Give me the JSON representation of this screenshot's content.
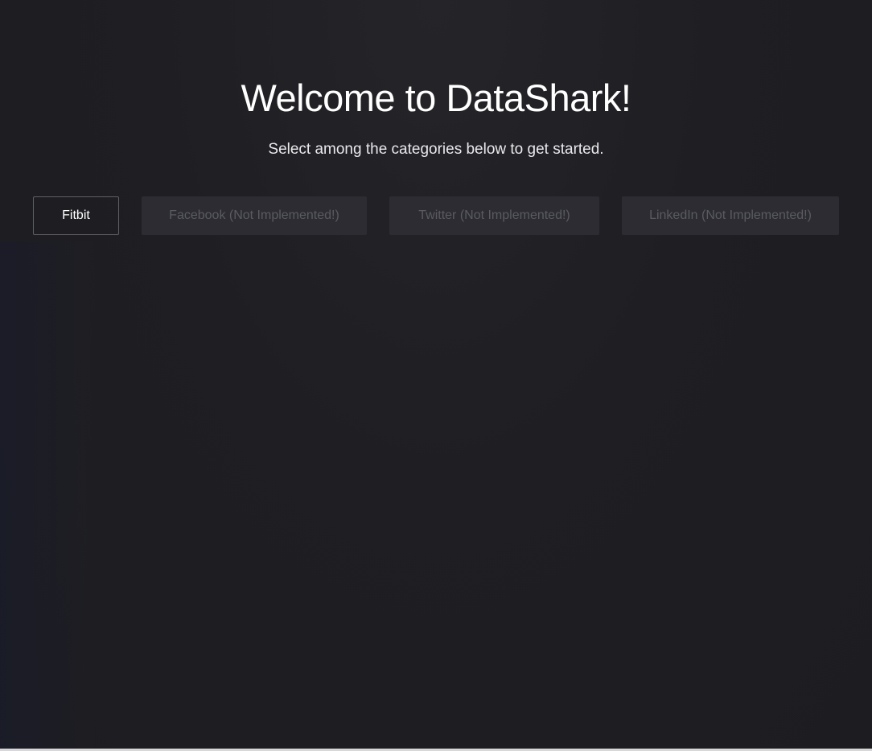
{
  "header": {
    "title": "Welcome to DataShark!",
    "subtitle": "Select among the categories below to get started."
  },
  "categories": [
    {
      "label": "Fitbit",
      "enabled": true
    },
    {
      "label": "Facebook (Not Implemented!)",
      "enabled": false
    },
    {
      "label": "Twitter (Not Implemented!)",
      "enabled": false
    },
    {
      "label": "LinkedIn (Not Implemented!)",
      "enabled": false
    }
  ],
  "colors": {
    "background": "#1f1f23",
    "button_disabled_bg": "#2c2c32",
    "button_disabled_text": "#5a5a62",
    "button_border": "#5e5e66",
    "text": "#ffffff"
  }
}
